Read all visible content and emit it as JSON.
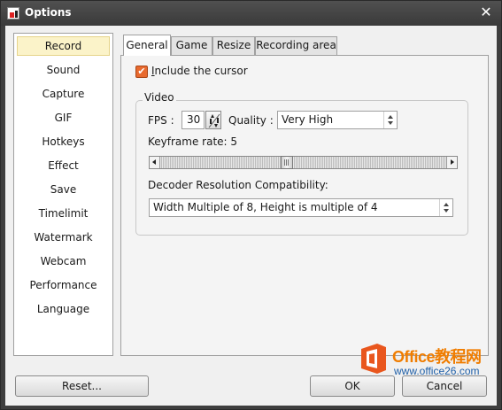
{
  "window": {
    "title": "Options",
    "close_glyph": "✕"
  },
  "sidebar": {
    "items": [
      {
        "label": "Record"
      },
      {
        "label": "Sound"
      },
      {
        "label": "Capture"
      },
      {
        "label": "GIF"
      },
      {
        "label": "Hotkeys"
      },
      {
        "label": "Effect"
      },
      {
        "label": "Save"
      },
      {
        "label": "Timelimit"
      },
      {
        "label": "Watermark"
      },
      {
        "label": "Webcam"
      },
      {
        "label": "Performance"
      },
      {
        "label": "Language"
      }
    ],
    "selected": "Record"
  },
  "tabs": [
    {
      "label": "General"
    },
    {
      "label": "Game"
    },
    {
      "label": "Resize"
    },
    {
      "label": "Recording area"
    }
  ],
  "active_tab": "General",
  "general": {
    "include_cursor": {
      "checked": true,
      "check_glyph": "✔",
      "accel_letter": "I",
      "rest_label": "nclude the cursor"
    },
    "video_group": {
      "title": "Video",
      "fps_label": "FPS :",
      "fps_value": "30",
      "quality_label": "Quality :",
      "quality_value": "Very High",
      "keyframe_label": "Keyframe rate: 5",
      "keyframe_rate": 5,
      "decoder_label": "Decoder Resolution Compatibility:",
      "decoder_value": "Width Multiple of 8, Height is multiple of 4"
    }
  },
  "buttons": {
    "reset": "Reset...",
    "ok": "OK",
    "cancel": "Cancel"
  },
  "watermark": {
    "brand": "Office教程网",
    "url": "www.office26.com",
    "brand_color": "#f07d00"
  },
  "colors": {
    "accent": "#e86a2f",
    "selection": "#fbf3c9",
    "titlebar": "#3e3e3e"
  }
}
